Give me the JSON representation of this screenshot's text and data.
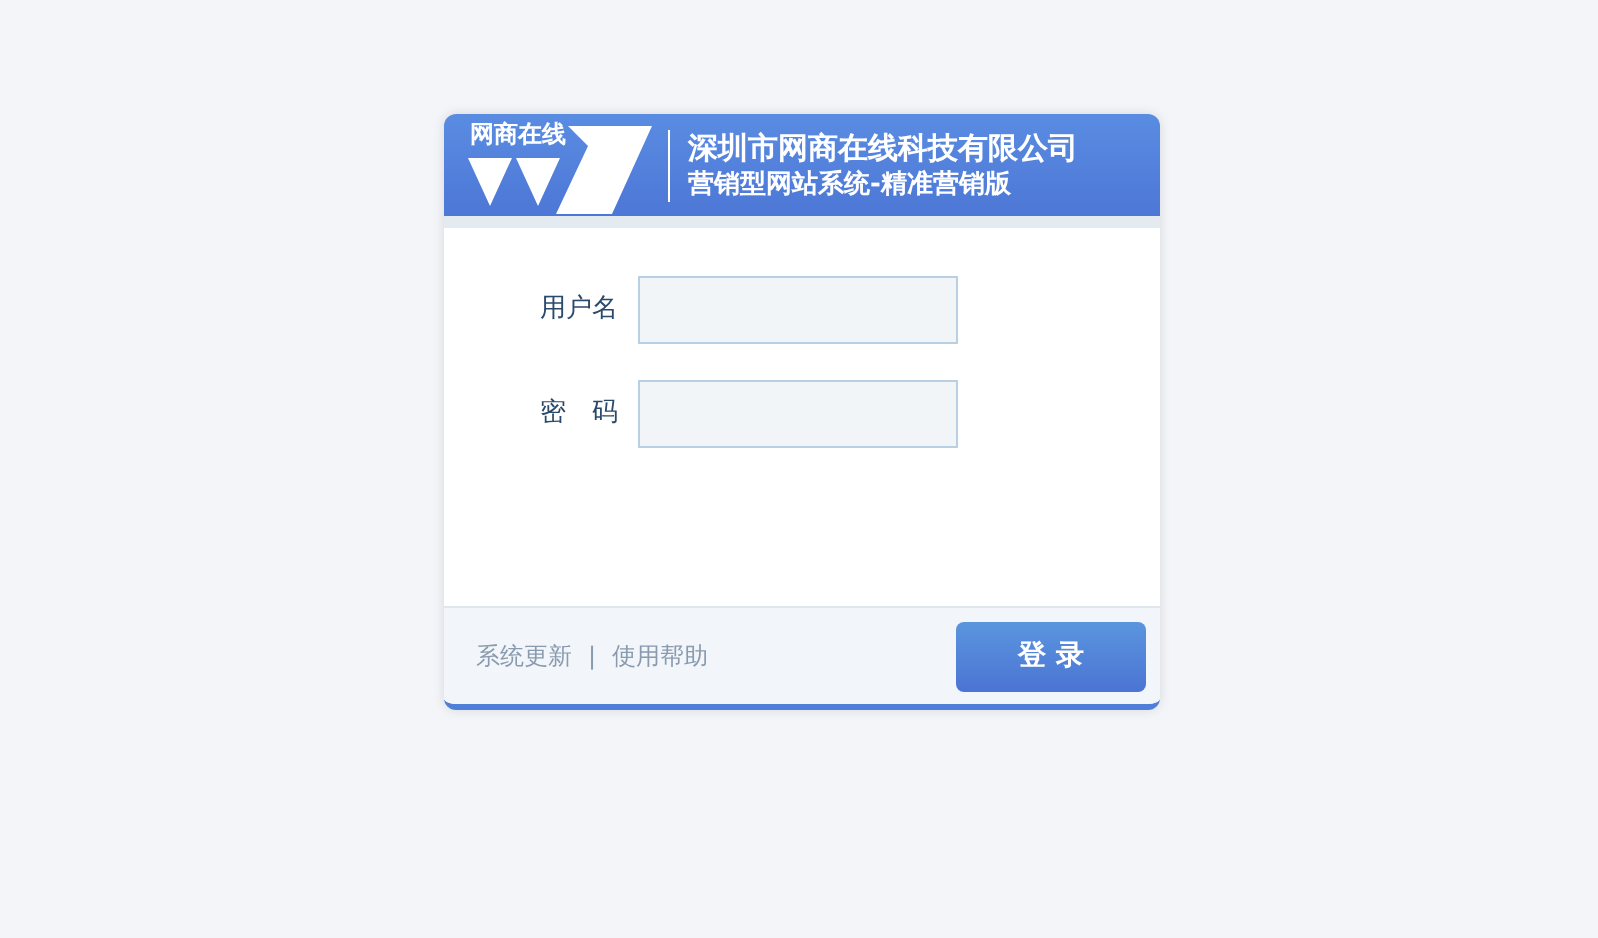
{
  "logo": {
    "text": "网商在线"
  },
  "header": {
    "company": "深圳市网商在线科技有限公司",
    "subtitle": "营销型网站系统-精准营销版"
  },
  "fields": [
    {
      "label": "用户名"
    },
    {
      "label": "密　码"
    }
  ],
  "footer_links": [
    "系统更新",
    "使用帮助"
  ],
  "footer_separator": "|",
  "login_button": "登 录"
}
